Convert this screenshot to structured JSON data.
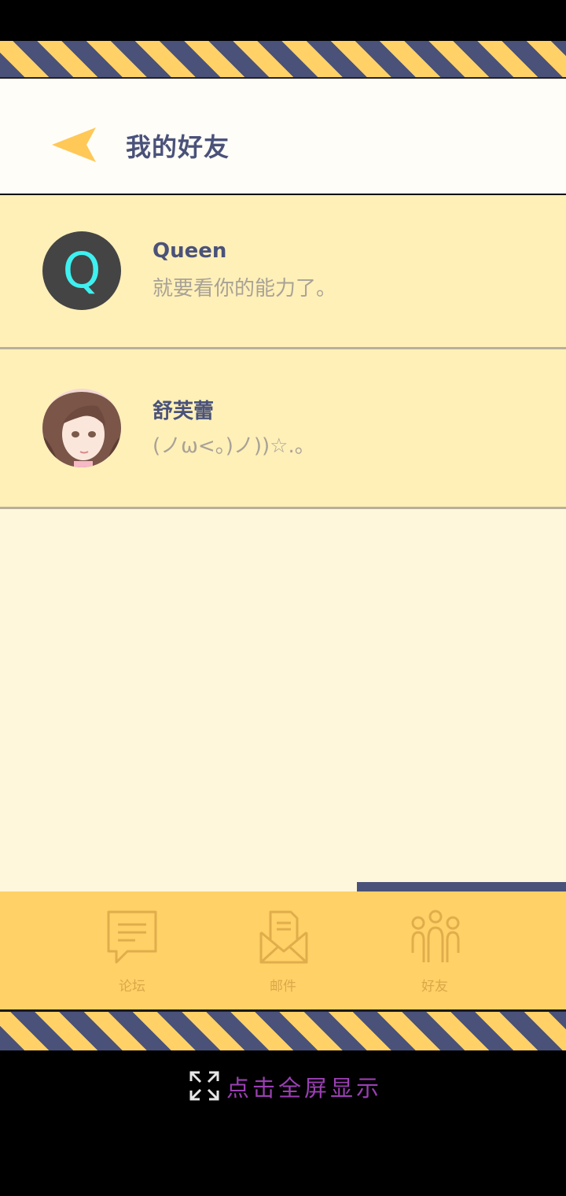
{
  "header": {
    "title": "我的好友"
  },
  "friends": [
    {
      "name": "Queen",
      "message": "就要看你的能力了。",
      "avatar_letter": "Q"
    },
    {
      "name": "舒芙蕾",
      "message": "(ノω<。)ノ))☆.。"
    }
  ],
  "tabs": [
    {
      "label": "论坛",
      "icon": "chat-icon"
    },
    {
      "label": "邮件",
      "icon": "mail-icon"
    },
    {
      "label": "好友",
      "icon": "friends-icon"
    }
  ],
  "active_tab": "好友",
  "fullscreen": {
    "label": "点击全屏显示"
  },
  "colors": {
    "accent": "#ffd166",
    "navy": "#4a527a",
    "list_bg": "#fff0b8",
    "page_bg": "#fff7dc"
  }
}
